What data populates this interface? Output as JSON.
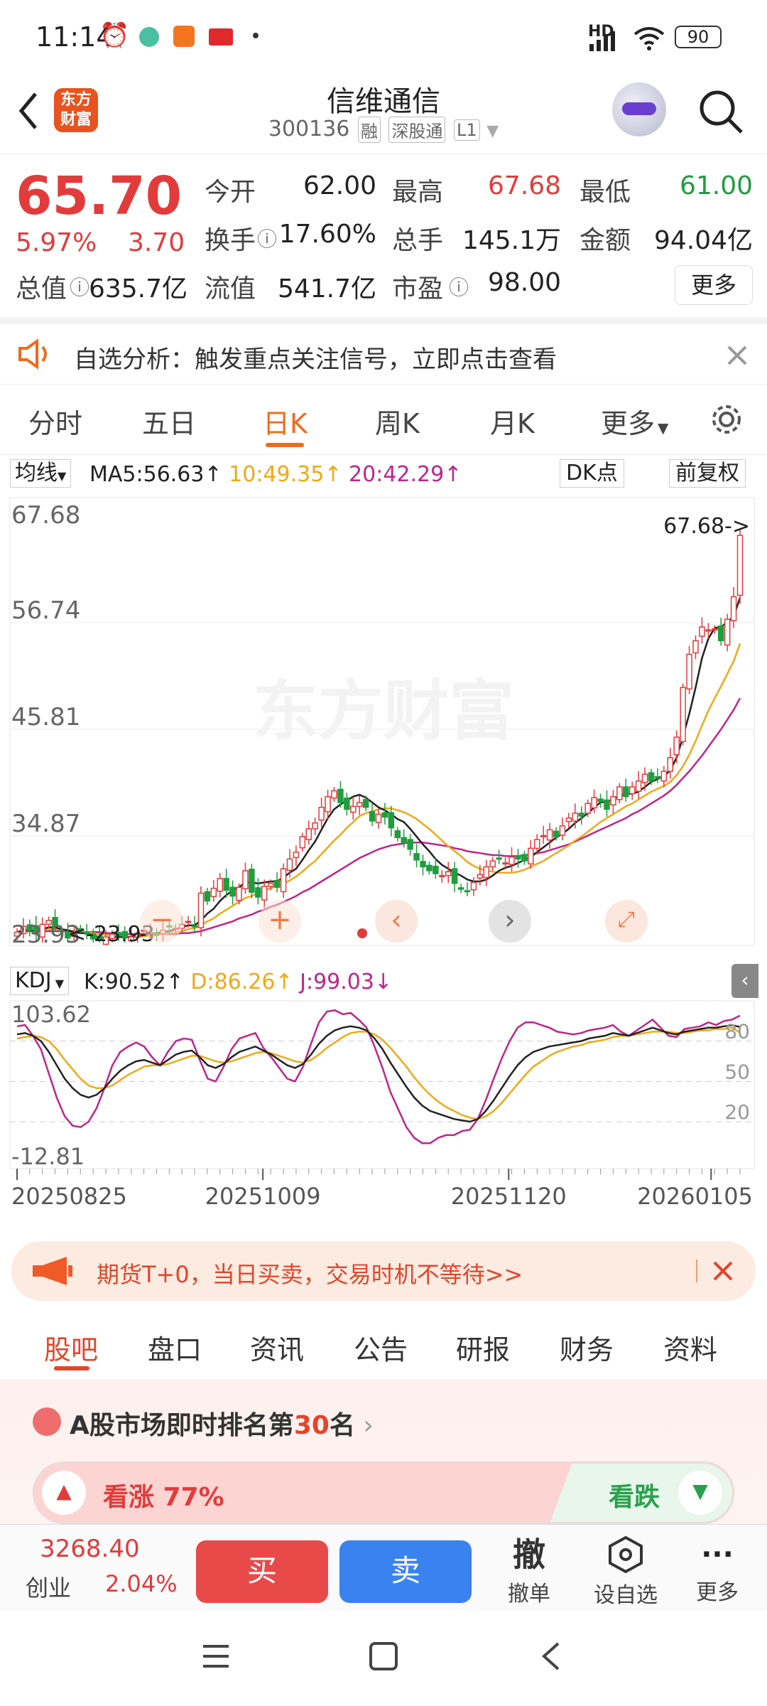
{
  "status": {
    "time": "11:14",
    "network": "HD",
    "battery": "90"
  },
  "header": {
    "name": "信维通信",
    "code": "300136",
    "tags": [
      "融",
      "深股通",
      "L1"
    ],
    "logo": "东方财富"
  },
  "quote": {
    "price": "65.70",
    "pct": "5.97%",
    "chg": "3.70",
    "items": [
      {
        "label": "今开",
        "value": "62.00",
        "color": "#222"
      },
      {
        "label": "最高",
        "value": "67.68",
        "color": "#e23b3b"
      },
      {
        "label": "最低",
        "value": "61.00",
        "color": "#1e9e3e"
      },
      {
        "label": "换手",
        "value": "17.60%",
        "color": "#222"
      },
      {
        "label": "总手",
        "value": "145.1万",
        "color": "#222"
      },
      {
        "label": "金额",
        "value": "94.04亿",
        "color": "#222"
      },
      {
        "label": "总值",
        "value": "635.7亿",
        "color": "#222"
      },
      {
        "label": "流值",
        "value": "541.7亿",
        "color": "#222"
      },
      {
        "label": "市盈",
        "value": "98.00",
        "color": "#222"
      }
    ],
    "more": "更多"
  },
  "notice": {
    "text": "自选分析：触发重点关注信号，立即点击查看"
  },
  "ktabs": [
    "分时",
    "五日",
    "日K",
    "周K",
    "月K",
    "更多"
  ],
  "ma": {
    "selector": "均线",
    "ma5": "MA5:56.63",
    "ma10": "10:49.35",
    "ma20": "20:42.29",
    "dk": "DK点",
    "fq": "前复权"
  },
  "kdj": {
    "selector": "KDJ",
    "k": "K:90.52",
    "d": "D:86.26",
    "j": "J:99.03"
  },
  "chart_data": {
    "type": "candlestick",
    "price_ticks": [
      "67.68",
      "56.74",
      "45.81",
      "34.87",
      "23.93"
    ],
    "ylim": [
      23.93,
      67.68
    ],
    "max_label": "67.68->",
    "min_label": "23.93",
    "kdj_ticks": [
      "103.62",
      "80",
      "50",
      "20",
      "-12.81"
    ],
    "kdj_ylim": [
      -12.81,
      103.62
    ],
    "x_ticks": [
      "20250825",
      "20251009",
      "20251120",
      "20260105"
    ],
    "close": [
      25,
      25.6,
      25.2,
      24.8,
      25.8,
      26.2,
      25.6,
      25.1,
      24.4,
      24.9,
      25.3,
      24.8,
      24.3,
      24.2,
      24.5,
      24.8,
      24.6,
      24.4,
      24.5,
      24.9,
      25.2,
      25.0,
      24.7,
      25.2,
      25.6,
      25.4,
      25.8,
      26.1,
      25.6,
      29.0,
      28.2,
      29.5,
      30.5,
      29.3,
      28.7,
      29.6,
      31.3,
      29.1,
      28.6,
      29.7,
      30.0,
      29.6,
      31.5,
      32.5,
      33.2,
      34.8,
      35.6,
      36.2,
      37.8,
      38.9,
      39.5,
      38.3,
      37.6,
      37.9,
      38.3,
      37.8,
      36.4,
      37.1,
      36.8,
      35.7,
      34.7,
      34.2,
      33.5,
      32.4,
      31.7,
      31.3,
      31.0,
      30.8,
      31.2,
      30.0,
      29.4,
      29.2,
      30.1,
      30.9,
      31.7,
      32.3,
      32.5,
      32.1,
      32.7,
      32.5,
      32.3,
      33.6,
      34.5,
      34.9,
      35.5,
      34.8,
      35.9,
      36.7,
      37.2,
      36.9,
      38.2,
      38.8,
      38.4,
      37.6,
      38.9,
      39.9,
      38.9,
      39.9,
      40.5,
      41.2,
      40.5,
      40.8,
      41.5,
      42.9,
      45.0,
      50.1,
      53.5,
      54.9,
      56.3,
      56.0,
      56.1,
      54.9,
      57.1,
      59.4,
      65.7
    ],
    "ma5": [
      25,
      25.2,
      25.2,
      25.1,
      25.3,
      25.5,
      25.5,
      25.3,
      25.2,
      25.0,
      24.9,
      24.9,
      24.7,
      24.5,
      24.4,
      24.5,
      24.5,
      24.5,
      24.5,
      24.6,
      24.7,
      24.8,
      24.9,
      25.0,
      25.1,
      25.3,
      25.5,
      25.7,
      25.7,
      26.2,
      26.9,
      27.4,
      28.2,
      28.8,
      29.3,
      29.6,
      30.1,
      30.1,
      30.0,
      30.1,
      30.2,
      30.2,
      30.6,
      31.1,
      31.5,
      32.4,
      33.4,
      34.3,
      35.5,
      36.7,
      37.6,
      38.1,
      38.5,
      38.9,
      39.1,
      38.8,
      38.3,
      37.8,
      37.5,
      37.1,
      36.6,
      36.3,
      35.6,
      34.8,
      34.0,
      33.3,
      32.5,
      31.9,
      31.5,
      31.1,
      30.8,
      30.4,
      30.2,
      30.2,
      30.4,
      30.8,
      31.3,
      31.6,
      31.8,
      32.1,
      32.4,
      32.7,
      33.2,
      33.7,
      34.2,
      34.7,
      35.1,
      35.6,
      36.2,
      36.7,
      37.2,
      37.8,
      38.3,
      38.4,
      38.6,
      39.0,
      39.2,
      39.2,
      39.4,
      39.9,
      40.4,
      40.7,
      41.0,
      41.6,
      42.9,
      45.0,
      47.4,
      50.1,
      53.1,
      55.1,
      56.2,
      56.3,
      56.8,
      57.4,
      59.3
    ],
    "ma10": [
      25,
      25.1,
      25.2,
      25.2,
      25.2,
      25.3,
      25.3,
      25.3,
      25.2,
      25.1,
      25.0,
      25.0,
      24.9,
      24.8,
      24.7,
      24.7,
      24.6,
      24.6,
      24.5,
      24.5,
      24.6,
      24.6,
      24.7,
      24.8,
      24.9,
      25.0,
      25.1,
      25.3,
      25.4,
      25.7,
      26.1,
      26.4,
      26.9,
      27.3,
      27.7,
      28.1,
      28.5,
      28.7,
      29.0,
      29.3,
      29.5,
      29.7,
      30.0,
      30.3,
      30.7,
      31.2,
      31.8,
      32.3,
      33.0,
      33.7,
      34.4,
      35.0,
      35.7,
      36.3,
      36.9,
      37.2,
      37.4,
      37.6,
      37.7,
      37.7,
      37.5,
      37.3,
      37.0,
      36.6,
      36.1,
      35.6,
      35.0,
      34.4,
      33.8,
      33.3,
      32.8,
      32.2,
      31.8,
      31.5,
      31.3,
      31.2,
      31.1,
      31.1,
      31.1,
      31.2,
      31.4,
      31.7,
      32.0,
      32.3,
      32.7,
      33.1,
      33.5,
      33.9,
      34.4,
      34.8,
      35.3,
      35.8,
      36.3,
      36.7,
      37.1,
      37.5,
      37.9,
      38.2,
      38.6,
      39.0,
      39.4,
      39.7,
      40.0,
      40.4,
      41.1,
      42.0,
      43.2,
      44.6,
      46.2,
      47.7,
      49.0,
      50.2,
      51.5,
      52.8,
      54.6
    ],
    "ma20": [
      25,
      25,
      25.1,
      25.1,
      25.1,
      25.1,
      25.1,
      25.1,
      25.1,
      25.1,
      25.1,
      25.0,
      25.0,
      25.0,
      24.9,
      24.9,
      24.9,
      24.8,
      24.8,
      24.8,
      24.8,
      24.8,
      24.8,
      24.8,
      24.8,
      24.8,
      24.9,
      24.9,
      25.0,
      25.1,
      25.3,
      25.5,
      25.7,
      25.9,
      26.1,
      26.4,
      26.6,
      26.8,
      27.1,
      27.3,
      27.6,
      27.8,
      28.1,
      28.4,
      28.7,
      29.1,
      29.4,
      29.8,
      30.2,
      30.6,
      31.0,
      31.4,
      31.8,
      32.2,
      32.6,
      32.9,
      33.2,
      33.5,
      33.7,
      33.9,
      34.0,
      34.1,
      34.2,
      34.2,
      34.2,
      34.1,
      34.0,
      33.9,
      33.8,
      33.6,
      33.5,
      33.3,
      33.2,
      33.1,
      33.0,
      32.9,
      32.9,
      32.8,
      32.8,
      32.8,
      32.9,
      33.0,
      33.1,
      33.2,
      33.4,
      33.6,
      33.8,
      34.0,
      34.3,
      34.6,
      34.9,
      35.2,
      35.5,
      35.8,
      36.1,
      36.4,
      36.7,
      37.1,
      37.4,
      37.8,
      38.2,
      38.6,
      39.0,
      39.5,
      40.1,
      40.8,
      41.5,
      42.3,
      43.1,
      44.0,
      44.9,
      45.8,
      46.8,
      47.8,
      49.0
    ],
    "k": [
      85,
      86,
      84,
      80,
      72,
      62,
      52,
      45,
      40,
      38,
      40,
      45,
      52,
      58,
      62,
      65,
      66,
      64,
      62,
      66,
      70,
      72,
      73,
      68,
      62,
      60,
      63,
      68,
      72,
      74,
      76,
      73,
      70,
      66,
      62,
      60,
      63,
      70,
      78,
      84,
      88,
      90,
      91,
      90,
      88,
      82,
      74,
      64,
      55,
      46,
      38,
      32,
      28,
      26,
      24,
      22,
      21,
      20,
      22,
      28,
      36,
      45,
      54,
      62,
      68,
      72,
      74,
      76,
      77,
      78,
      79,
      80,
      82,
      83,
      84,
      86,
      85,
      84,
      86,
      88,
      90,
      88,
      86,
      85,
      87,
      88,
      89,
      90,
      90,
      91,
      92,
      90.5
    ],
    "d": [
      82,
      83,
      84,
      83,
      80,
      74,
      66,
      59,
      52,
      47,
      45,
      45,
      47,
      51,
      55,
      58,
      61,
      62,
      62,
      63,
      65,
      67,
      69,
      69,
      67,
      65,
      64,
      65,
      67,
      69,
      71,
      72,
      71,
      69,
      67,
      65,
      64,
      66,
      70,
      75,
      79,
      83,
      86,
      87,
      87,
      85,
      81,
      75,
      68,
      61,
      53,
      46,
      40,
      35,
      31,
      28,
      25,
      23,
      22,
      24,
      28,
      34,
      41,
      48,
      55,
      61,
      65,
      69,
      72,
      74,
      76,
      77,
      79,
      80,
      81,
      83,
      84,
      84,
      85,
      86,
      87,
      87,
      87,
      86,
      86,
      87,
      88,
      88,
      89,
      89,
      90,
      86.3
    ],
    "j": [
      91,
      92,
      84,
      74,
      56,
      38,
      24,
      17,
      16,
      20,
      30,
      45,
      62,
      72,
      76,
      79,
      76,
      68,
      62,
      72,
      80,
      82,
      81,
      66,
      52,
      50,
      61,
      74,
      82,
      84,
      86,
      75,
      68,
      60,
      52,
      50,
      61,
      78,
      94,
      102,
      103,
      100,
      101,
      96,
      90,
      76,
      60,
      42,
      29,
      16,
      8,
      4,
      4,
      8,
      10,
      10,
      13,
      14,
      22,
      36,
      52,
      67,
      80,
      90,
      94,
      94,
      92,
      90,
      87,
      86,
      85,
      86,
      88,
      89,
      90,
      92,
      87,
      84,
      88,
      92,
      96,
      90,
      84,
      83,
      89,
      90,
      91,
      94,
      92,
      95,
      96,
      99
    ]
  },
  "watermark": "东方财富",
  "ad": {
    "text": "期货T+0，当日买卖，交易时机不等待>>"
  },
  "btabs": [
    "股吧",
    "盘口",
    "资讯",
    "公告",
    "研报",
    "财务",
    "资料"
  ],
  "rank": {
    "pre": "A股市场即时排名第",
    "num": "30",
    "post": "名"
  },
  "sentiment": {
    "up": "看涨 77%",
    "down": "看跌",
    "up_pct": 77
  },
  "bottom": {
    "index_val": "3268.40",
    "index_name": "创业",
    "index_pct": "2.04%",
    "buy": "买",
    "sell": "卖",
    "cancel_glyph": "撤",
    "cancel": "撤单",
    "watch": "设自选",
    "more": "更多"
  }
}
